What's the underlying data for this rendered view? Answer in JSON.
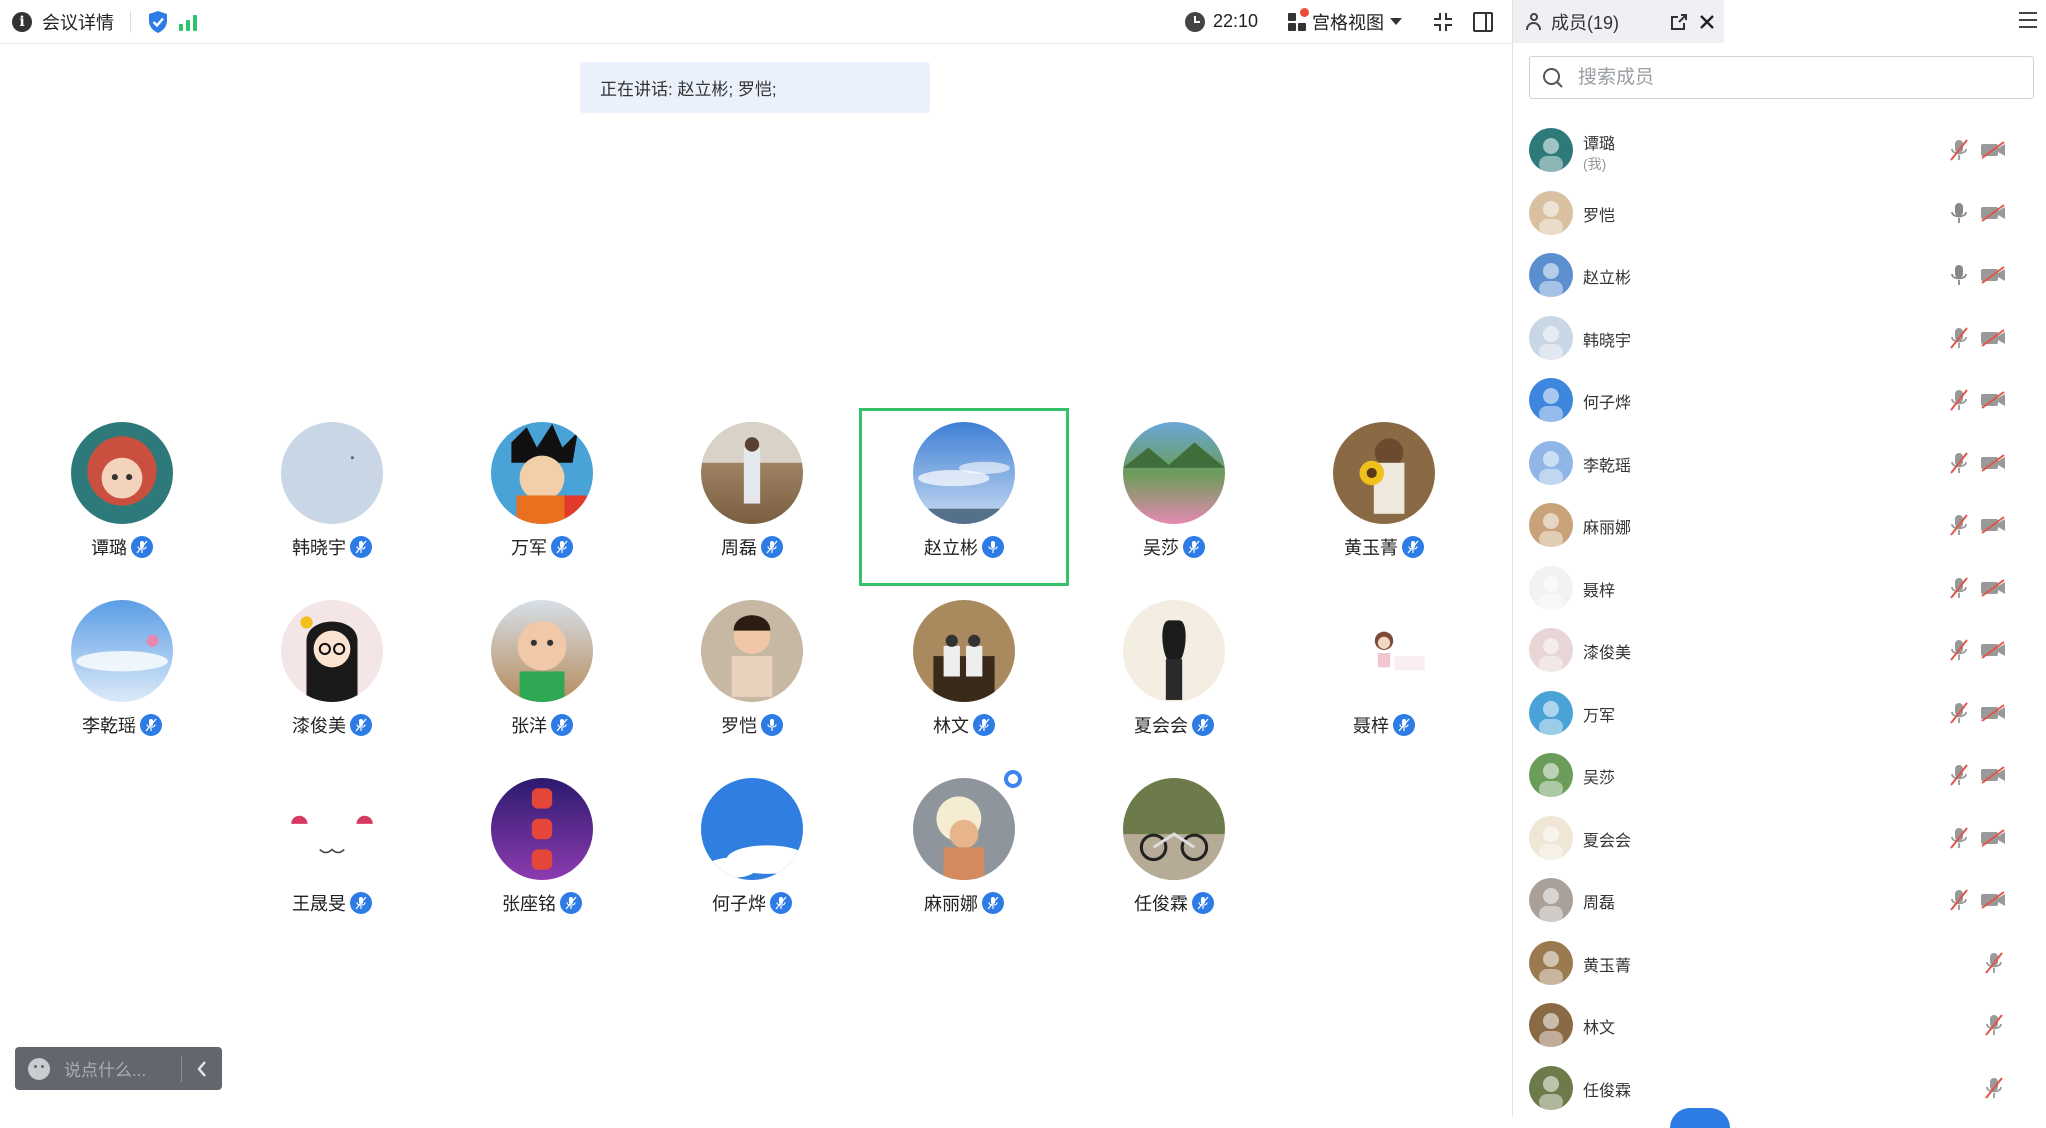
{
  "topbar": {
    "meeting_details": "会议详情",
    "time": "22:10",
    "view_mode": "宫格视图"
  },
  "speaking_banner": "正在讲话: 赵立彬; 罗恺;",
  "grid": [
    {
      "name": "谭璐",
      "mic": "muted"
    },
    {
      "name": "韩晓宇",
      "mic": "muted"
    },
    {
      "name": "万军",
      "mic": "muted"
    },
    {
      "name": "周磊",
      "mic": "muted"
    },
    {
      "name": "赵立彬",
      "mic": "on",
      "active": true
    },
    {
      "name": "吴莎",
      "mic": "muted"
    },
    {
      "name": "黄玉菁",
      "mic": "muted"
    },
    {
      "name": "李乾瑶",
      "mic": "muted"
    },
    {
      "name": "漆俊美",
      "mic": "muted"
    },
    {
      "name": "张洋",
      "mic": "muted"
    },
    {
      "name": "罗恺",
      "mic": "on"
    },
    {
      "name": "林文",
      "mic": "muted"
    },
    {
      "name": "夏会会",
      "mic": "muted"
    },
    {
      "name": "聂梓",
      "mic": "muted"
    },
    {
      "name": "王晟旻",
      "mic": "muted"
    },
    {
      "name": "张座铭",
      "mic": "muted"
    },
    {
      "name": "何子烨",
      "mic": "muted"
    },
    {
      "name": "麻丽娜",
      "mic": "muted"
    },
    {
      "name": "任俊霖",
      "mic": "muted"
    }
  ],
  "chat": {
    "placeholder": "说点什么..."
  },
  "panel": {
    "tab_label": "成员(19)",
    "search_placeholder": "搜索成员",
    "members": [
      {
        "name": "谭璐",
        "sub": "(我)",
        "mic": "muted",
        "cam": "off"
      },
      {
        "name": "罗恺",
        "mic": "on",
        "cam": "off"
      },
      {
        "name": "赵立彬",
        "mic": "on",
        "cam": "off"
      },
      {
        "name": "韩晓宇",
        "mic": "muted",
        "cam": "off"
      },
      {
        "name": "何子烨",
        "mic": "muted",
        "cam": "off"
      },
      {
        "name": "李乾瑶",
        "mic": "muted",
        "cam": "off"
      },
      {
        "name": "麻丽娜",
        "mic": "muted",
        "cam": "off"
      },
      {
        "name": "聂梓",
        "mic": "muted",
        "cam": "off"
      },
      {
        "name": "漆俊美",
        "mic": "muted",
        "cam": "off"
      },
      {
        "name": "万军",
        "mic": "muted",
        "cam": "off"
      },
      {
        "name": "吴莎",
        "mic": "muted",
        "cam": "off"
      },
      {
        "name": "夏会会",
        "mic": "muted",
        "cam": "off"
      },
      {
        "name": "周磊",
        "mic": "muted",
        "cam": "off"
      },
      {
        "name": "黄玉菁",
        "mic": "muted"
      },
      {
        "name": "林文",
        "mic": "muted"
      },
      {
        "name": "任俊霖",
        "mic": "muted"
      }
    ]
  },
  "colors": {
    "accent": "#2d7be5",
    "active_border": "#36c26b",
    "banner_bg": "#eaf1fc"
  }
}
